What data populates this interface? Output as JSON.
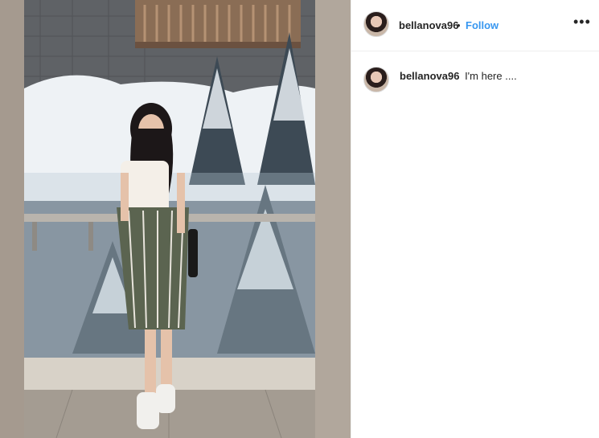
{
  "post": {
    "username": "bellanova96",
    "separator": "•",
    "follow_label": "Follow",
    "more_icon": "•••",
    "caption": {
      "username": "bellanova96",
      "text": "I'm here ...."
    }
  },
  "colors": {
    "follow": "#3897f0",
    "text": "#262626",
    "divider": "#efefef"
  }
}
